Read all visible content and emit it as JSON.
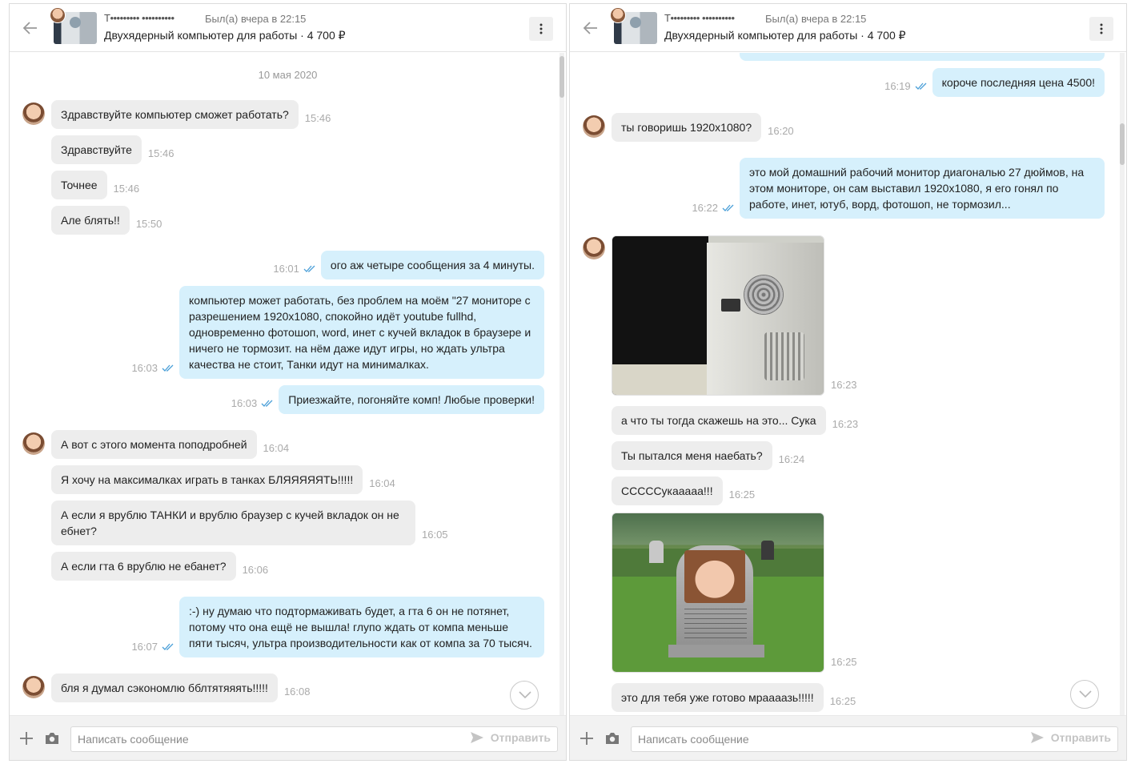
{
  "left": {
    "header": {
      "name": "Т••••••••• ••••••••••",
      "status": "Был(а) вчера в 22:15",
      "ad": "Двухядерный компьютер для работы · 4 700 ₽"
    },
    "date": "10 мая 2020",
    "messages": [
      {
        "text": "Здравствуйте компьютер сможет работать?",
        "time": "15:46"
      },
      {
        "text": "Здравствуйте",
        "time": "15:46"
      },
      {
        "text": "Точнее",
        "time": "15:46"
      },
      {
        "text": "Але блять!!",
        "time": "15:50"
      },
      {
        "text": "ого аж четыре сообщения за 4 минуты.",
        "time": "16:01"
      },
      {
        "text": "компьютер может работать, без проблем на моём \"27 мониторе с разрешением 1920x1080, спокойно идёт youtube fullhd, одновременно фотошоп, word, инет с кучей вкладок в браузере и ничего не тормозит.  на нём даже идут игры, но ждать ультра качества не стоит, Танки идут на минималках.",
        "time": "16:03"
      },
      {
        "text": "Приезжайте, погоняйте комп! Любые проверки!",
        "time": "16:03"
      },
      {
        "text": "А вот с этого момента поподробней",
        "time": "16:04"
      },
      {
        "text": "Я хочу на максималках играть в танках БЛЯЯЯЯЯТЬ!!!!!",
        "time": "16:04"
      },
      {
        "text": "А если я врублю ТАНКИ и врублю браузер с кучей вкладок он не ебнет?",
        "time": "16:05"
      },
      {
        "text": "А если гта 6 врублю не ебанет?",
        "time": "16:06"
      },
      {
        "text": ":-) ну думаю что подтормаживать будет, а гта 6 он не потянет, потому что она ещё не вышла! глупо ждать от компа меньше пяти тысяч, ультра производительности как от компа за 70 тысяч.",
        "time": "16:07"
      },
      {
        "text": "бля я думал сэкономлю бблтятяяять!!!!!",
        "time": "16:08"
      }
    ]
  },
  "right": {
    "header": {
      "name": "Т••••••••• ••••••••••",
      "status": "Был(а) вчера в 22:15",
      "ad": "Двухядерный компьютер для работы · 4 700 ₽"
    },
    "messages": [
      {
        "text": "короче последняя цена 4500!",
        "time": "16:19"
      },
      {
        "text": "ты говоришь 1920x1080?",
        "time": "16:20"
      },
      {
        "text": "это мой домашний рабочий монитор диагональю 27 дюймов, на этом мониторе, он сам выставил  1920x1080,  я его гонял по работе, инет, ютуб, ворд, фотошоп, не тормозил...",
        "time": "16:22"
      },
      {
        "text": "",
        "time": "16:23"
      },
      {
        "text": "а что ты тогда скажешь на это... Сука",
        "time": "16:23"
      },
      {
        "text": "Ты пытался меня наебать?",
        "time": "16:24"
      },
      {
        "text": "СССССукааааа!!!",
        "time": "16:25"
      },
      {
        "text": "",
        "time": "16:25"
      },
      {
        "text": "это для тебя уже готово мраааазь!!!!!",
        "time": "16:25"
      }
    ]
  },
  "composer": {
    "placeholder": "Написать сообщение",
    "send_label": "Отправить"
  },
  "icons": {
    "back": "arrow-left-icon",
    "more": "vertical-dots-icon",
    "read": "double-check-icon",
    "add": "plus-icon",
    "camera": "camera-icon",
    "send": "paper-plane-icon",
    "scroll_down": "chevron-down-icon"
  },
  "colors": {
    "outgoing_bubble": "#d6f0fc",
    "incoming_bubble": "#ededed",
    "read_tick": "#4a9fd8"
  }
}
